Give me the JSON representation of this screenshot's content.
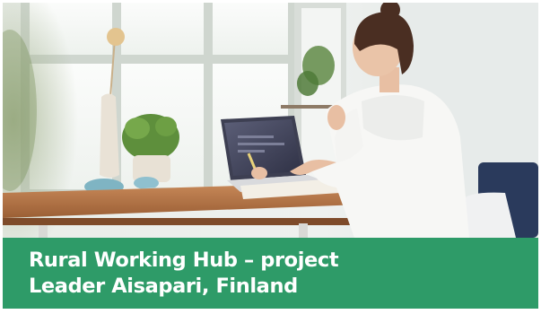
{
  "card": {
    "title_lines": [
      "Rural Working Hub – project",
      "Leader Aisapari, Finland"
    ],
    "banner_color": "#2e9b68",
    "image_subject": "woman-working-on-laptop-photo"
  }
}
